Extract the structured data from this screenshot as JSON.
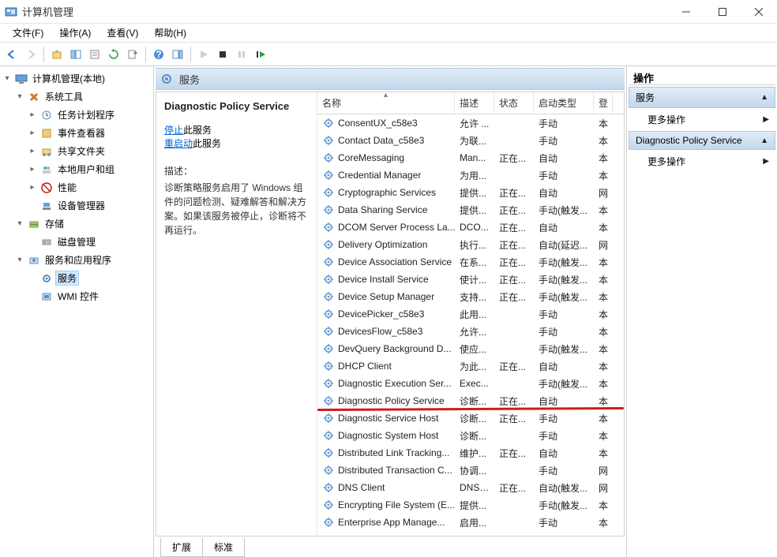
{
  "window": {
    "title": "计算机管理"
  },
  "menus": {
    "file": "文件(F)",
    "action": "操作(A)",
    "view": "查看(V)",
    "help": "帮助(H)"
  },
  "tree": {
    "root": "计算机管理(本地)",
    "system_tools": "系统工具",
    "task_scheduler": "任务计划程序",
    "event_viewer": "事件查看器",
    "shared_folders": "共享文件夹",
    "local_users": "本地用户和组",
    "performance": "性能",
    "device_manager": "设备管理器",
    "storage": "存储",
    "disk_management": "磁盘管理",
    "services_apps": "服务和应用程序",
    "services": "服务",
    "wmi_control": "WMI 控件"
  },
  "mid_header": {
    "title": "服务"
  },
  "detail": {
    "title": "Diagnostic Policy Service",
    "stop_link": "停止",
    "stop_suffix": "此服务",
    "restart_link": "重启动",
    "restart_suffix": "此服务",
    "desc_label": "描述：",
    "desc_text": "诊断策略服务启用了 Windows 组件的问题检测、疑难解答和解决方案。如果该服务被停止，诊断将不再运行。"
  },
  "columns": {
    "name": "名称",
    "desc": "描述",
    "status": "状态",
    "start": "启动类型",
    "logon": "登"
  },
  "services": [
    {
      "name": "ConsentUX_c58e3",
      "desc": "允许 ...",
      "status": "",
      "start": "手动",
      "logon": "本"
    },
    {
      "name": "Contact Data_c58e3",
      "desc": "为联...",
      "status": "",
      "start": "手动",
      "logon": "本"
    },
    {
      "name": "CoreMessaging",
      "desc": "Man...",
      "status": "正在...",
      "start": "自动",
      "logon": "本"
    },
    {
      "name": "Credential Manager",
      "desc": "为用...",
      "status": "",
      "start": "手动",
      "logon": "本"
    },
    {
      "name": "Cryptographic Services",
      "desc": "提供...",
      "status": "正在...",
      "start": "自动",
      "logon": "网"
    },
    {
      "name": "Data Sharing Service",
      "desc": "提供...",
      "status": "正在...",
      "start": "手动(触发...",
      "logon": "本"
    },
    {
      "name": "DCOM Server Process La...",
      "desc": "DCO...",
      "status": "正在...",
      "start": "自动",
      "logon": "本"
    },
    {
      "name": "Delivery Optimization",
      "desc": "执行...",
      "status": "正在...",
      "start": "自动(延迟...",
      "logon": "网"
    },
    {
      "name": "Device Association Service",
      "desc": "在系...",
      "status": "正在...",
      "start": "手动(触发...",
      "logon": "本"
    },
    {
      "name": "Device Install Service",
      "desc": "使计...",
      "status": "正在...",
      "start": "手动(触发...",
      "logon": "本"
    },
    {
      "name": "Device Setup Manager",
      "desc": "支持...",
      "status": "正在...",
      "start": "手动(触发...",
      "logon": "本"
    },
    {
      "name": "DevicePicker_c58e3",
      "desc": "此用...",
      "status": "",
      "start": "手动",
      "logon": "本"
    },
    {
      "name": "DevicesFlow_c58e3",
      "desc": "允许...",
      "status": "",
      "start": "手动",
      "logon": "本"
    },
    {
      "name": "DevQuery Background D...",
      "desc": "使应...",
      "status": "",
      "start": "手动(触发...",
      "logon": "本"
    },
    {
      "name": "DHCP Client",
      "desc": "为此...",
      "status": "正在...",
      "start": "自动",
      "logon": "本"
    },
    {
      "name": "Diagnostic Execution Ser...",
      "desc": "Exec...",
      "status": "",
      "start": "手动(触发...",
      "logon": "本"
    },
    {
      "name": "Diagnostic Policy Service",
      "desc": "诊断...",
      "status": "正在...",
      "start": "自动",
      "logon": "本",
      "highlight": true
    },
    {
      "name": "Diagnostic Service Host",
      "desc": "诊断...",
      "status": "正在...",
      "start": "手动",
      "logon": "本"
    },
    {
      "name": "Diagnostic System Host",
      "desc": "诊断...",
      "status": "",
      "start": "手动",
      "logon": "本"
    },
    {
      "name": "Distributed Link Tracking...",
      "desc": "维护...",
      "status": "正在...",
      "start": "自动",
      "logon": "本"
    },
    {
      "name": "Distributed Transaction C...",
      "desc": "协调...",
      "status": "",
      "start": "手动",
      "logon": "网"
    },
    {
      "name": "DNS Client",
      "desc": "DNS ...",
      "status": "正在...",
      "start": "自动(触发...",
      "logon": "网"
    },
    {
      "name": "Encrypting File System (E...",
      "desc": "提供...",
      "status": "",
      "start": "手动(触发...",
      "logon": "本"
    },
    {
      "name": "Enterprise App Manage...",
      "desc": "启用...",
      "status": "",
      "start": "手动",
      "logon": "本"
    }
  ],
  "tabs": {
    "extended": "扩展",
    "standard": "标准"
  },
  "actions": {
    "title": "操作",
    "section1": "服务",
    "more1": "更多操作",
    "section2": "Diagnostic Policy Service",
    "more2": "更多操作"
  }
}
